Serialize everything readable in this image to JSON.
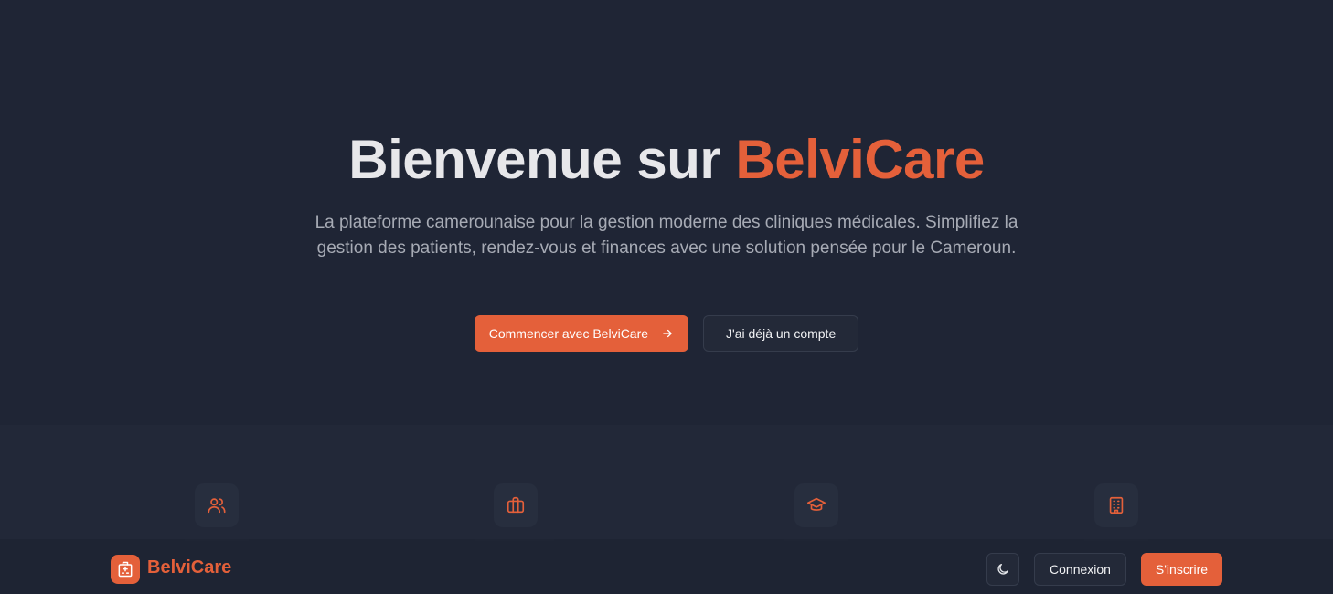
{
  "hero": {
    "title_prefix": "Bienvenue sur ",
    "title_brand": "BelviCare",
    "subtitle": "La plateforme camerounaise pour la gestion moderne des cliniques médicales. Simplifiez la gestion des patients, rendez-vous et finances avec une solution pensée pour le Cameroun.",
    "primary_cta": "Commencer avec BelviCare",
    "secondary_cta": "J'ai déjà un compte"
  },
  "features": {
    "icons": [
      "users-icon",
      "briefcase-icon",
      "graduation-cap-icon",
      "building-icon"
    ]
  },
  "navbar": {
    "brand": "BelviCare",
    "login_label": "Connexion",
    "signup_label": "S'inscrire",
    "theme_icon": "moon-icon"
  },
  "colors": {
    "accent": "#e4603a",
    "background": "#1f2535",
    "surface": "#232938"
  }
}
